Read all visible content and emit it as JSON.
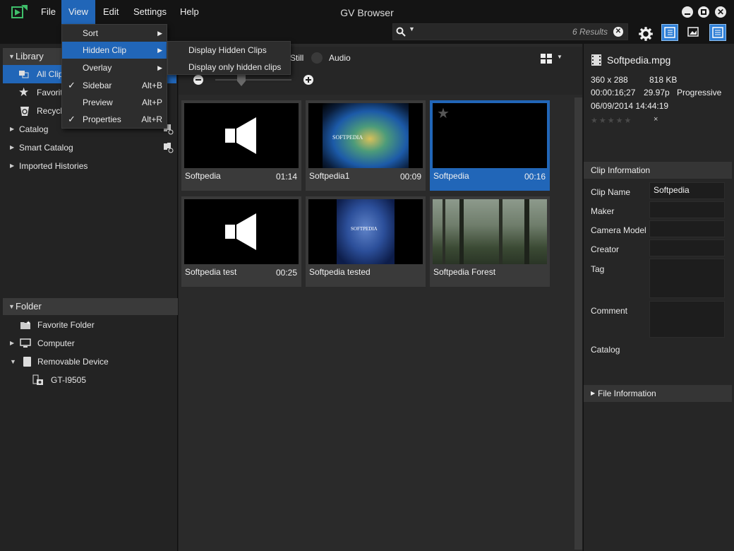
{
  "app": {
    "title": "GV Browser",
    "menu": [
      "File",
      "View",
      "Edit",
      "Settings",
      "Help"
    ]
  },
  "toolbar": {
    "search_value": "",
    "search_count": "6 Results"
  },
  "view_menu": {
    "items": [
      {
        "label": "Sort",
        "submenu": true,
        "checked": false,
        "shortcut": ""
      },
      {
        "label": "Hidden Clip",
        "submenu": true,
        "checked": false,
        "shortcut": "",
        "highlighted": true
      },
      {
        "label": "Overlay",
        "submenu": true,
        "checked": false,
        "shortcut": ""
      },
      {
        "label": "Sidebar",
        "submenu": false,
        "checked": true,
        "shortcut": "Alt+B"
      },
      {
        "label": "Preview",
        "submenu": false,
        "checked": false,
        "shortcut": "Alt+P"
      },
      {
        "label": "Properties",
        "submenu": false,
        "checked": true,
        "shortcut": "Alt+R"
      }
    ]
  },
  "hidden_clip_submenu": {
    "items": [
      "Display Hidden Clips",
      "Display only hidden clips"
    ]
  },
  "sidebar": {
    "library_header": "Library",
    "library_items": [
      {
        "label": "All Clip",
        "icon": "clips-icon",
        "selected": true
      },
      {
        "label": "Favorit",
        "icon": "star-icon"
      },
      {
        "label": "Recycl",
        "icon": "recycle-icon"
      },
      {
        "label": "Catalog",
        "icon": "catalog-add-icon",
        "expandable": true
      },
      {
        "label": "Smart Catalog",
        "icon": "smart-catalog-add-icon",
        "expandable": true
      },
      {
        "label": "Imported Histories",
        "expandable": true
      }
    ],
    "folder_header": "Folder",
    "folder_items": [
      {
        "label": "Favorite Folder",
        "icon": "favorite-folder-icon"
      },
      {
        "label": "Computer",
        "icon": "computer-icon",
        "expandable": true
      },
      {
        "label": "Removable Device",
        "icon": "removable-device-icon",
        "expanded": true
      },
      {
        "label": "GT-I9505",
        "icon": "camera-device-icon"
      }
    ]
  },
  "filters": {
    "still": "Still",
    "audio": "Audio"
  },
  "clips": [
    {
      "name": "Softpedia",
      "duration": "01:14",
      "thumb": "audio"
    },
    {
      "name": "Softpedia1",
      "duration": "00:09",
      "thumb": "video-swirl"
    },
    {
      "name": "Softpedia",
      "duration": "00:16",
      "thumb": "black",
      "selected": true
    },
    {
      "name": "Softpedia test",
      "duration": "00:25",
      "thumb": "audio"
    },
    {
      "name": "Softpedia tested",
      "duration": "",
      "thumb": "blue-title"
    },
    {
      "name": "Softpedia Forest",
      "duration": "",
      "thumb": "forest"
    }
  ],
  "properties": {
    "filename": "Softpedia.mpg",
    "resolution": "360 x 288",
    "size": "818 KB",
    "timecode": "00:00:16;27",
    "fps": "29.97p",
    "scan": "Progressive",
    "date": "06/09/2014 14:44:19",
    "clear_rating": "×",
    "rating": 0,
    "clip_info_header": "Clip Information",
    "fields": [
      {
        "label": "Clip Name",
        "value": "Softpedia"
      },
      {
        "label": "Maker",
        "value": ""
      },
      {
        "label": "Camera Model",
        "value": ""
      },
      {
        "label": "Creator",
        "value": ""
      },
      {
        "label": "Tag",
        "value": ""
      },
      {
        "label": "Comment",
        "value": ""
      },
      {
        "label": "Catalog",
        "value": ""
      }
    ],
    "file_info_header": "File Information"
  },
  "watermark": "SOFTPEDIA",
  "colors": {
    "accent": "#2166b8",
    "background": "#1d1d1d"
  }
}
